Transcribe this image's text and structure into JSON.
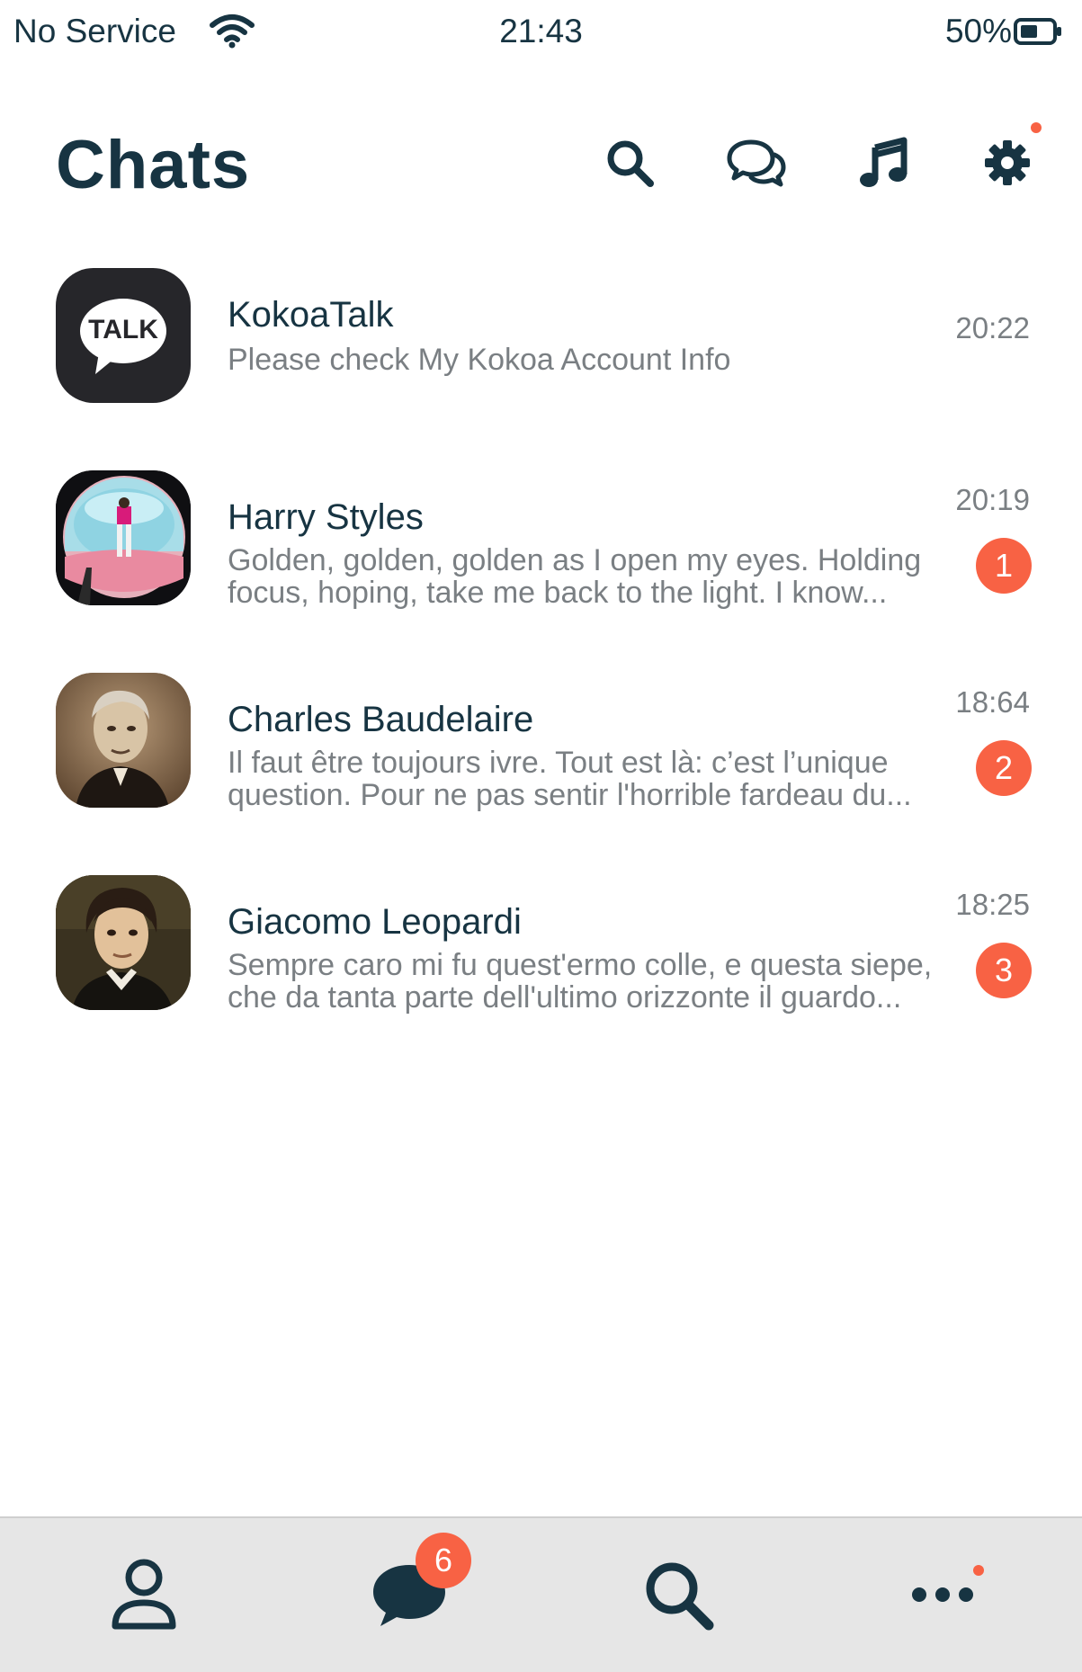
{
  "status_bar": {
    "carrier": "No Service",
    "time": "21:43",
    "battery": "50%",
    "wifi_icon": "wifi-icon",
    "battery_icon": "battery-icon"
  },
  "header": {
    "title": "Chats",
    "icons": [
      "search-icon",
      "chat-bubbles-icon",
      "music-note-icon",
      "gear-icon"
    ]
  },
  "chats": [
    {
      "name": "KokoaTalk",
      "message": "Please check My Kokoa Account Info",
      "time": "20:22",
      "unread": "",
      "avatar_text": "TALK"
    },
    {
      "name": "Harry Styles",
      "message": "Golden, golden, golden as I open my eyes. Holding focus, hoping, take me back to the light. I know...",
      "time": "20:19",
      "unread": "1"
    },
    {
      "name": "Charles Baudelaire",
      "message": "Il faut être toujours ivre. Tout est là: c’est l’unique question. Pour ne pas sentir l'horrible fardeau du...",
      "time": "18:64",
      "unread": "2"
    },
    {
      "name": "Giacomo Leopardi",
      "message": "Sempre caro mi fu quest'ermo colle, e questa siepe, che da tanta parte dell'ultimo orizzonte il guardo...",
      "time": "18:25",
      "unread": "3"
    }
  ],
  "tab_bar": {
    "tabs": [
      "person-icon",
      "chat-bubble-icon",
      "search-icon",
      "more-dots-icon"
    ],
    "chats_badge": "6"
  },
  "colors": {
    "primary": "#173442",
    "accent": "#f86244",
    "muted_text": "#7a7f83",
    "tab_bar_bg": "#e6e6e6"
  }
}
